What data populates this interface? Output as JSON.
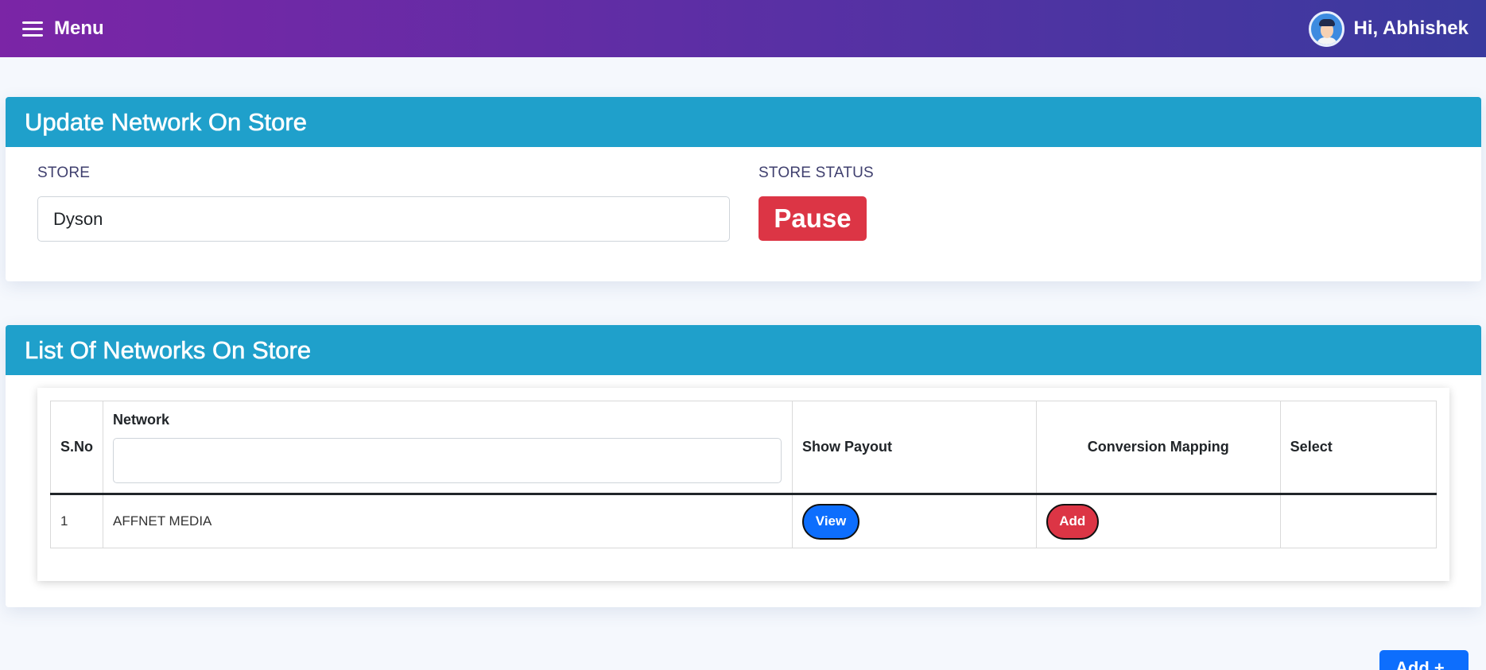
{
  "topbar": {
    "menu_label": "Menu",
    "greeting": "Hi, Abhishek",
    "menu_icon": "hamburger-icon",
    "avatar": "user-avatar"
  },
  "update_card": {
    "title": "Update Network On Store",
    "store_label": "STORE",
    "store_value": "Dyson",
    "status_label": "STORE STATUS",
    "status_button": "Pause",
    "status_color": "#dc3545"
  },
  "list_card": {
    "title": "List Of Networks On Store",
    "columns": {
      "sno": "S.No",
      "network": "Network",
      "show_payout": "Show Payout",
      "conversion_mapping": "Conversion Mapping",
      "select": "Select"
    },
    "network_filter_value": "",
    "rows": [
      {
        "sno": "1",
        "network": "AFFNET MEDIA",
        "payout_button": "View",
        "mapping_button": "Add",
        "select": ""
      }
    ]
  },
  "footer": {
    "add_button": "Add +"
  },
  "colors": {
    "header_gradient_start": "#7b25a6",
    "header_gradient_end": "#3a3a9e",
    "card_header": "#1fa0cb",
    "primary": "#0d6efd",
    "danger": "#dc3545"
  }
}
